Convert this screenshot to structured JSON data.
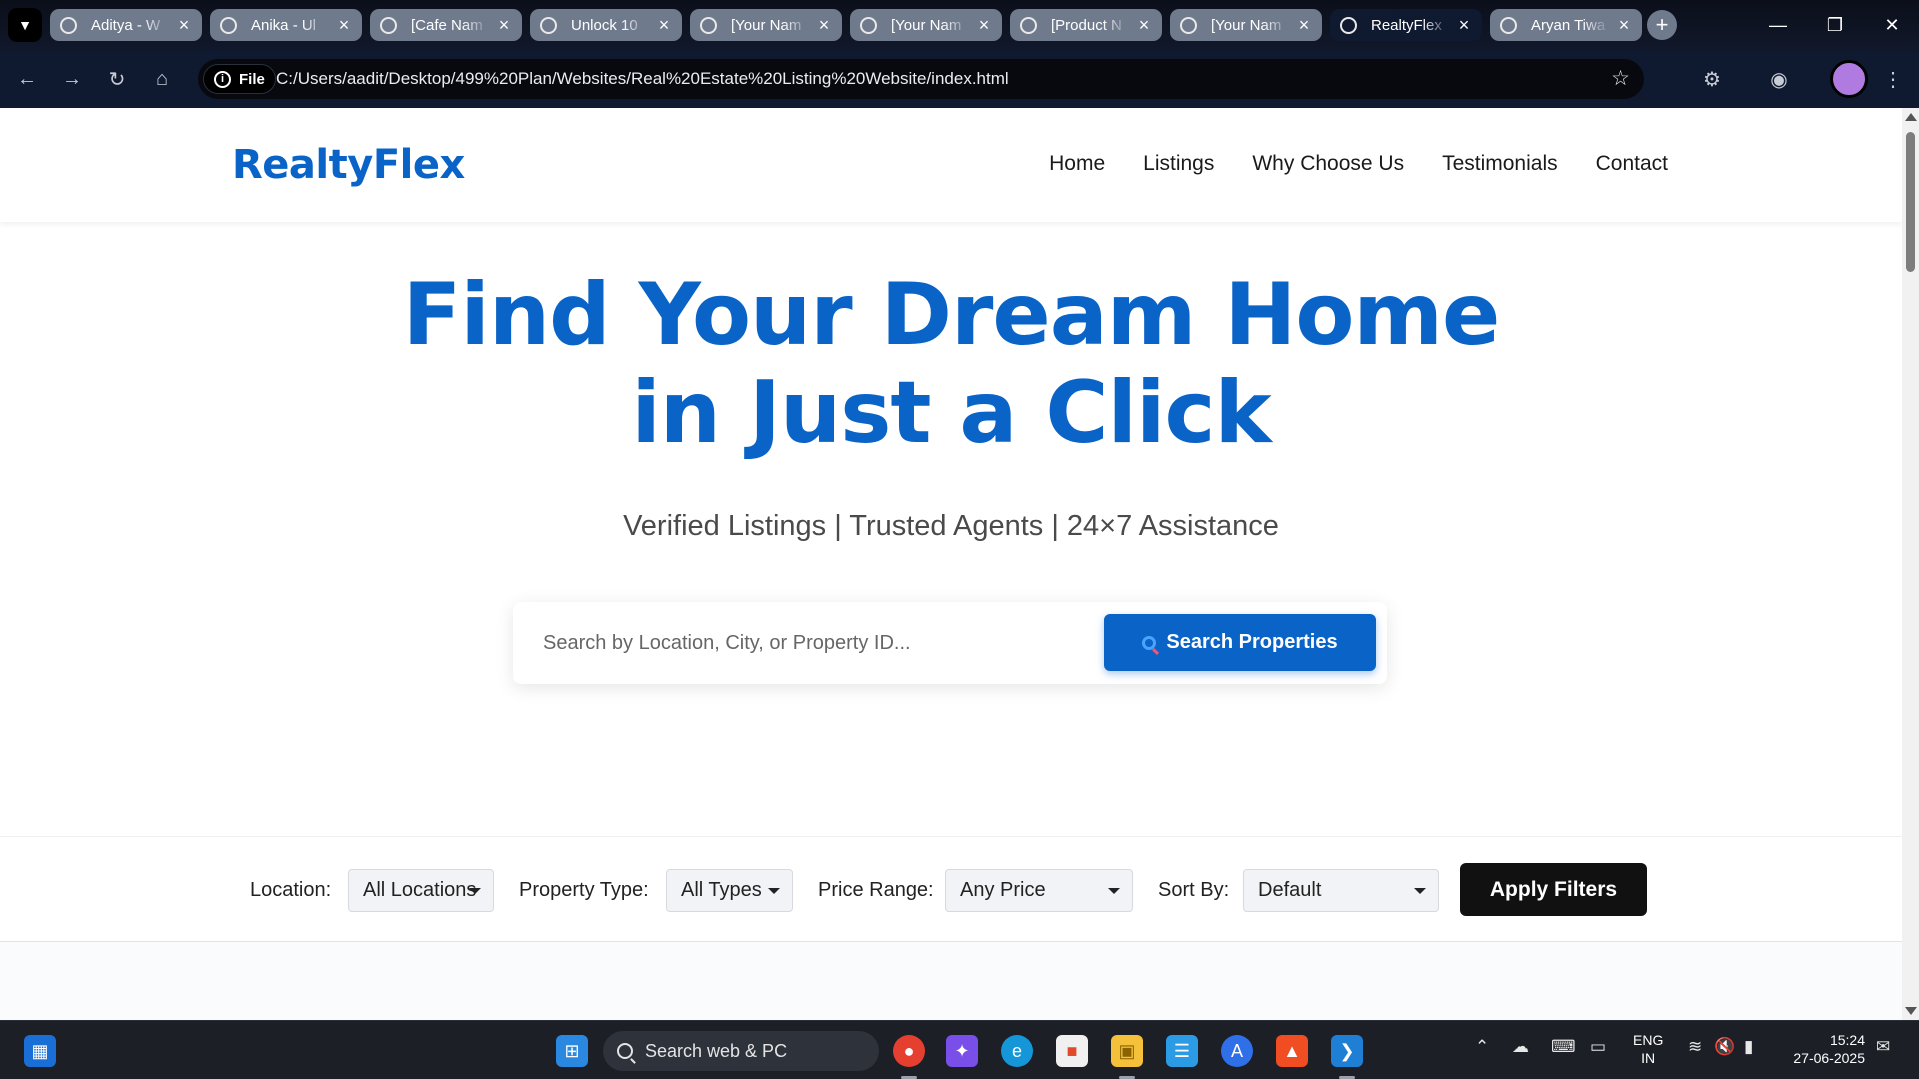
{
  "browser": {
    "tabs": [
      {
        "title": "Aditya - W"
      },
      {
        "title": "Anika - Ul"
      },
      {
        "title": "[Cafe Nam"
      },
      {
        "title": "Unlock 10"
      },
      {
        "title": "[Your Nam"
      },
      {
        "title": "[Your Nam"
      },
      {
        "title": "[Product N"
      },
      {
        "title": "[Your Nam"
      },
      {
        "title": "RealtyFlex"
      },
      {
        "title": "Aryan Tiwa"
      }
    ],
    "active_tab_index": 8,
    "chip_label": "File",
    "url": "C:/Users/aadit/Desktop/499%20Plan/Websites/Real%20Estate%20Listing%20Website/index.html"
  },
  "site": {
    "logo": "RealtyFlex",
    "nav": [
      "Home",
      "Listings",
      "Why Choose Us",
      "Testimonials",
      "Contact"
    ],
    "hero": {
      "title_line1": "Find Your Dream Home",
      "title_line2": "in Just a Click",
      "subtitle": "Verified Listings | Trusted Agents | 24×7 Assistance"
    },
    "search": {
      "placeholder": "Search by Location, City, or Property ID...",
      "value": "",
      "button_label": "Search Properties"
    },
    "filters": {
      "location_label": "Location:",
      "location_value": "All Locations",
      "type_label": "Property Type:",
      "type_value": "All Types",
      "price_label": "Price Range:",
      "price_value": "Any Price",
      "sort_label": "Sort By:",
      "sort_value": "Default",
      "apply_label": "Apply Filters"
    },
    "brand_color": "#0a64c8"
  },
  "taskbar": {
    "search_label": "Search web & PC",
    "lang_line1": "ENG",
    "lang_line2": "IN",
    "time": "15:24",
    "date": "27-06-2025"
  }
}
